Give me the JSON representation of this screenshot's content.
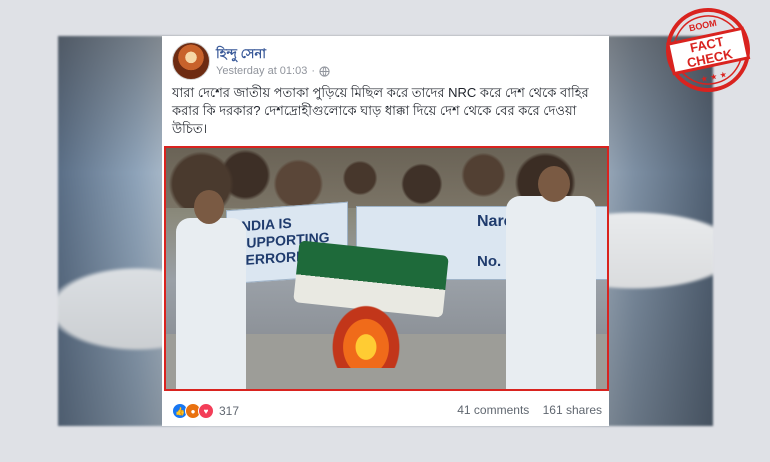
{
  "post": {
    "page_name": "হিন্দু সেনা",
    "timestamp": "Yesterday at 01:03",
    "text": "যারা দেশের জাতীয় পতাকা পুড়িয়ে মিছিল করে তাদের NRC করে দেশ থেকে বাহির করার কি দরকার? দেশদ্রোহীগুলোকে ঘাড় ধাক্কা দিয়ে দেশ থেকে বের করে দেওয়া উচিত।"
  },
  "photo": {
    "banner_left": "INDIA IS\nSUPPORTING\nTERRORISM",
    "banner_right_top": "Narend",
    "banner_right_bottom": "No. One T"
  },
  "footer": {
    "reaction_count": "317",
    "comments": "41 comments",
    "shares": "161 shares",
    "reactions": [
      "like-icon",
      "angry-icon",
      "love-icon"
    ]
  },
  "stamp": {
    "top": "BOOM",
    "line1": "FACT",
    "line2": "CHECK"
  },
  "colors": {
    "link": "#385898",
    "highlight_border": "#d9231f",
    "stamp_red": "#d9231f"
  }
}
